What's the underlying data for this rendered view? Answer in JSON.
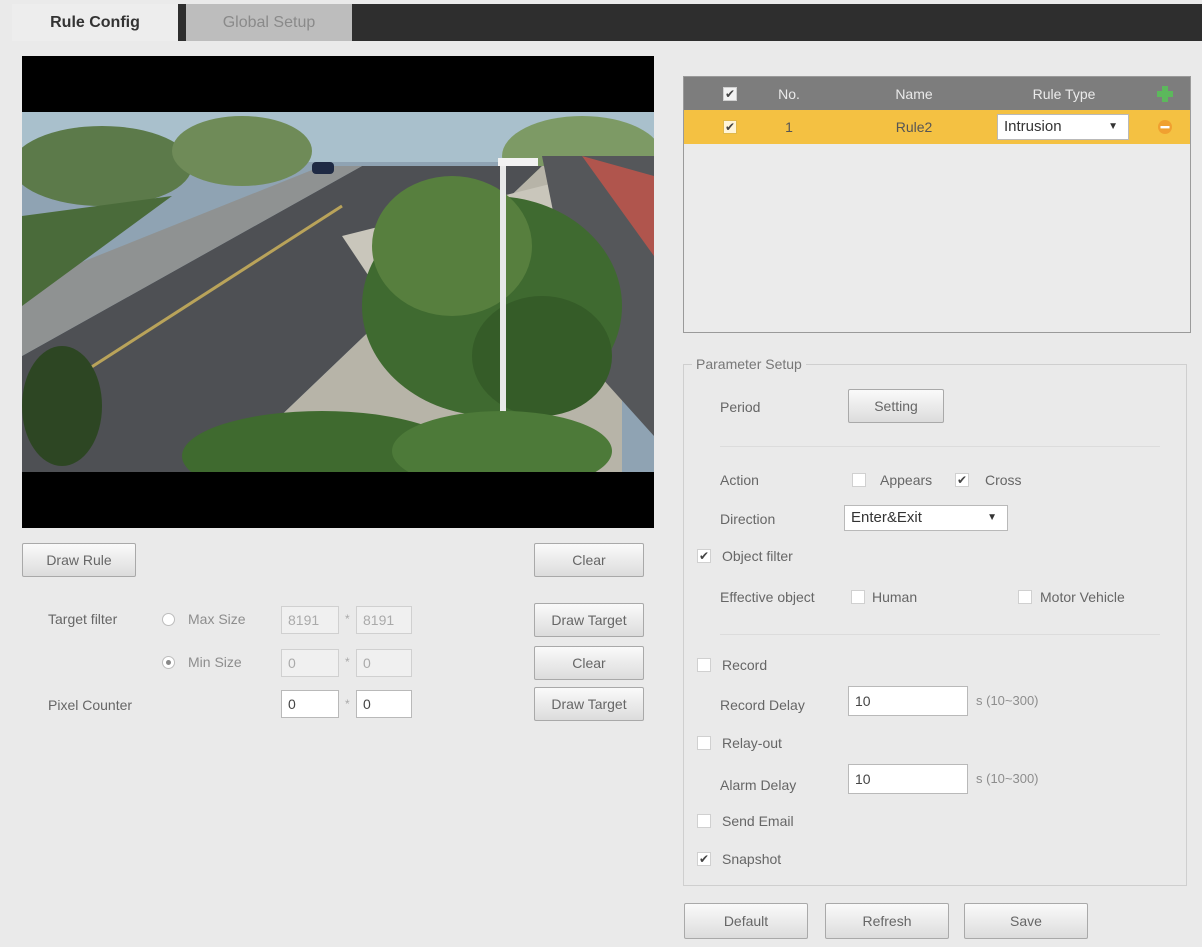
{
  "tabs": {
    "rule_config": "Rule Config",
    "global_setup": "Global Setup"
  },
  "left": {
    "draw_rule": "Draw Rule",
    "clear": "Clear",
    "target_filter_label": "Target filter",
    "max_size_label": "Max Size",
    "max_w": "8191",
    "max_h": "8191",
    "min_size_label": "Min Size",
    "min_w": "0",
    "min_h": "0",
    "times": "*",
    "draw_target": "Draw Target",
    "clear2": "Clear",
    "pixel_counter_label": "Pixel Counter",
    "pix_w": "0",
    "pix_h": "0",
    "draw_target2": "Draw Target"
  },
  "rules": {
    "headers": {
      "no": "No.",
      "name": "Name",
      "type": "Rule Type"
    },
    "row": {
      "no": "1",
      "name": "Rule2",
      "type": "Intrusion"
    }
  },
  "params": {
    "legend": "Parameter Setup",
    "period_label": "Period",
    "setting_button": "Setting",
    "action_label": "Action",
    "appears": "Appears",
    "cross": "Cross",
    "direction_label": "Direction",
    "direction_value": "Enter&Exit",
    "object_filter": "Object filter",
    "effective_object": "Effective object",
    "human": "Human",
    "motor_vehicle": "Motor Vehicle",
    "record": "Record",
    "record_delay_label": "Record Delay",
    "record_delay": "10",
    "record_delay_unit": "s (10~300)",
    "relay_out": "Relay-out",
    "alarm_delay_label": "Alarm Delay",
    "alarm_delay": "10",
    "alarm_delay_unit": "s (10~300)",
    "send_email": "Send Email",
    "snapshot": "Snapshot"
  },
  "footer": {
    "default": "Default",
    "refresh": "Refresh",
    "save": "Save"
  },
  "colors": {
    "selected_row": "#f4c142",
    "table_header": "#7d7d7d",
    "add_icon": "#5cb85c",
    "delete_icon": "#f0a030"
  }
}
